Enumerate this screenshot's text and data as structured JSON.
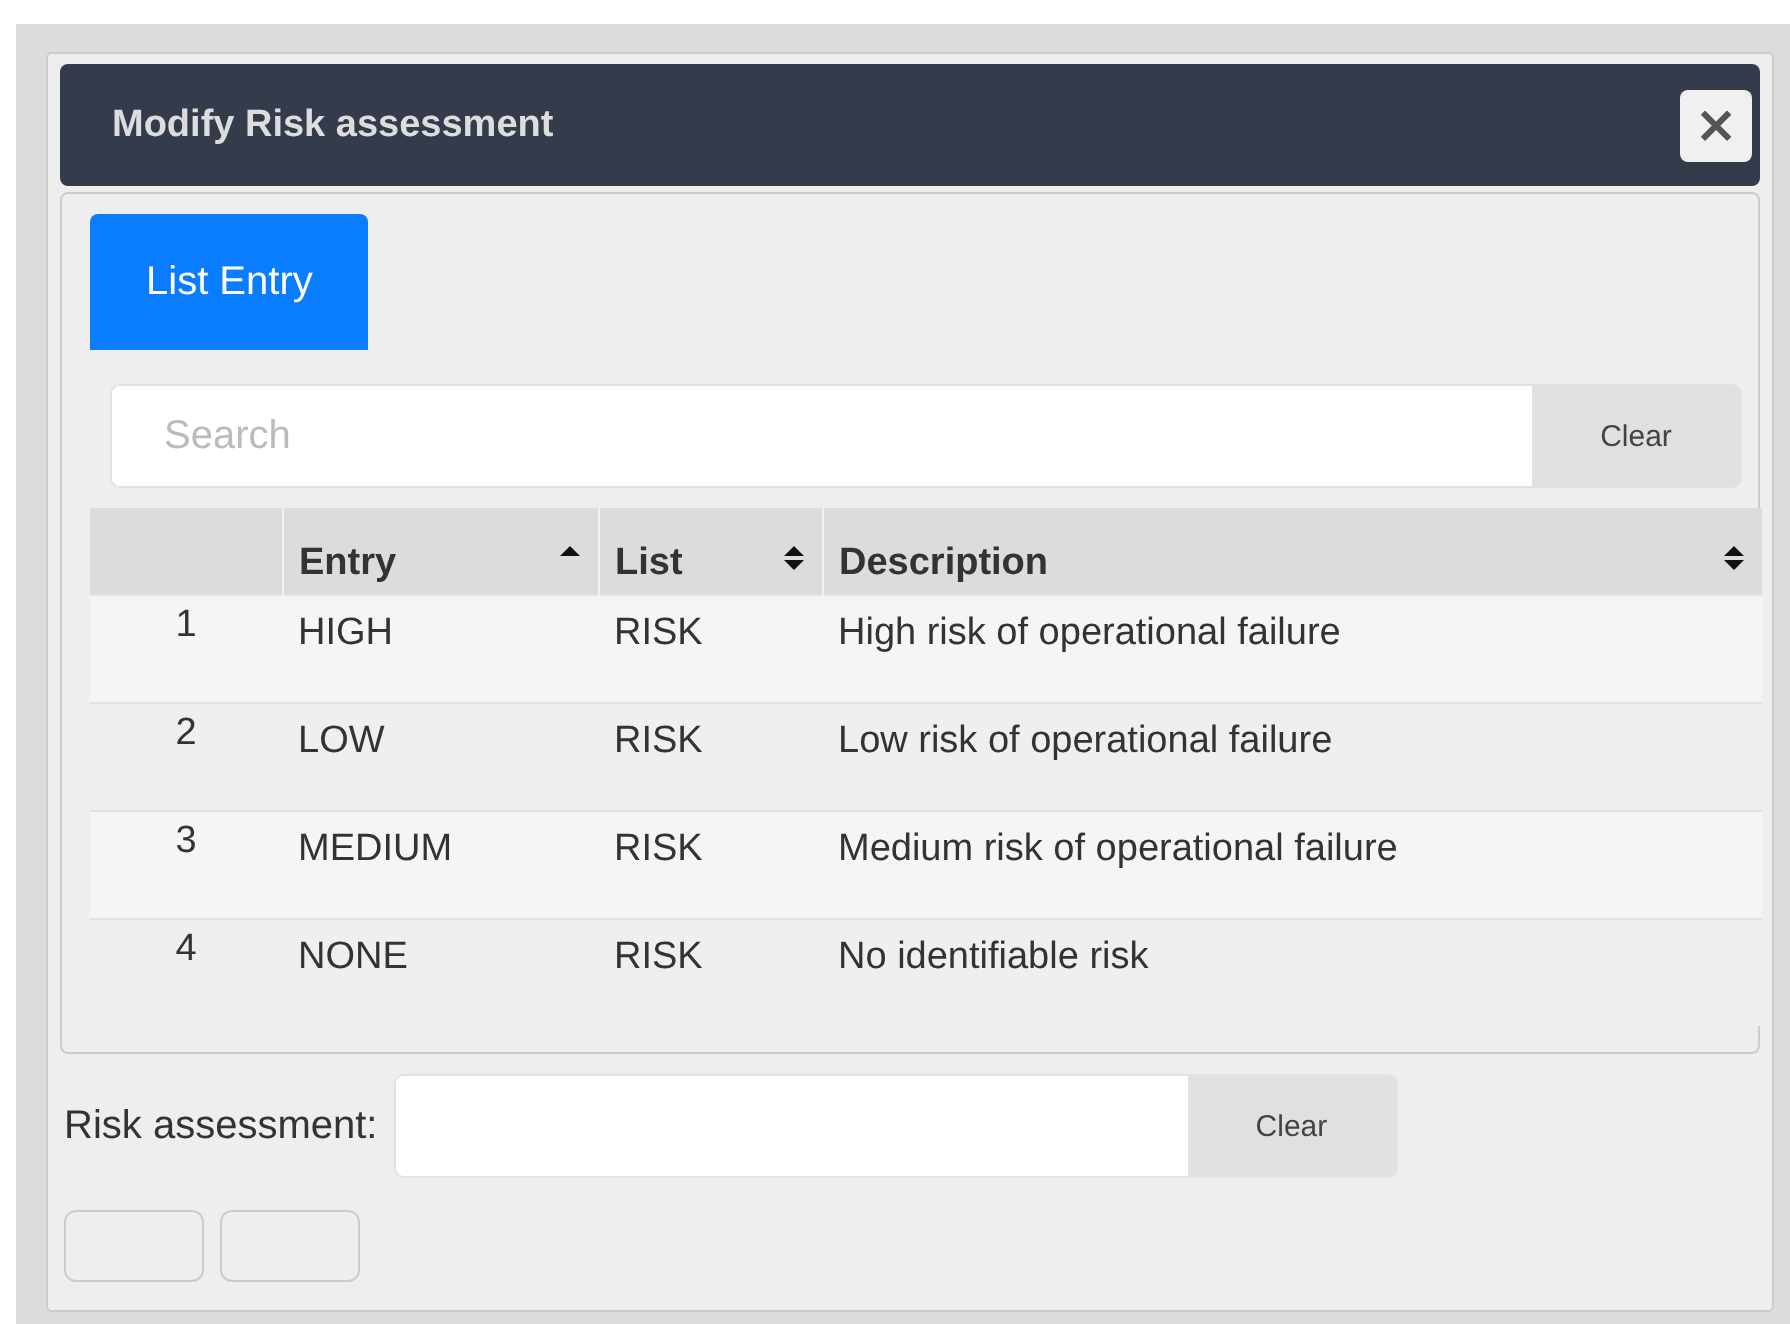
{
  "window": {
    "title": "Modify Risk assessment",
    "close": "×"
  },
  "tabs": [
    {
      "label": "List Entry",
      "selected": true
    }
  ],
  "search": {
    "placeholder": "Search",
    "clear": "Clear"
  },
  "table": {
    "columns": [
      {
        "label": "Entry",
        "sorted_ascending": true
      },
      {
        "label": "List",
        "sorted_ascending": false
      },
      {
        "label": "Description",
        "sorted_ascending": false
      }
    ],
    "rows": [
      {
        "index": "1",
        "entry": "HIGH",
        "list": "RISK",
        "description": "High risk of operational failure"
      },
      {
        "index": "2",
        "entry": "LOW",
        "list": "RISK",
        "description": "Low risk of operational failure"
      },
      {
        "index": "3",
        "entry": "MEDIUM",
        "list": "RISK",
        "description": "Medium risk of operational failure"
      },
      {
        "index": "4",
        "entry": "NONE",
        "list": "RISK",
        "description": "No identifiable risk"
      }
    ]
  },
  "field": {
    "label": "Risk assessment:",
    "clear": "Clear"
  },
  "footer_buttons": [
    {
      "disabled": false
    },
    {
      "disabled": false
    }
  ]
}
